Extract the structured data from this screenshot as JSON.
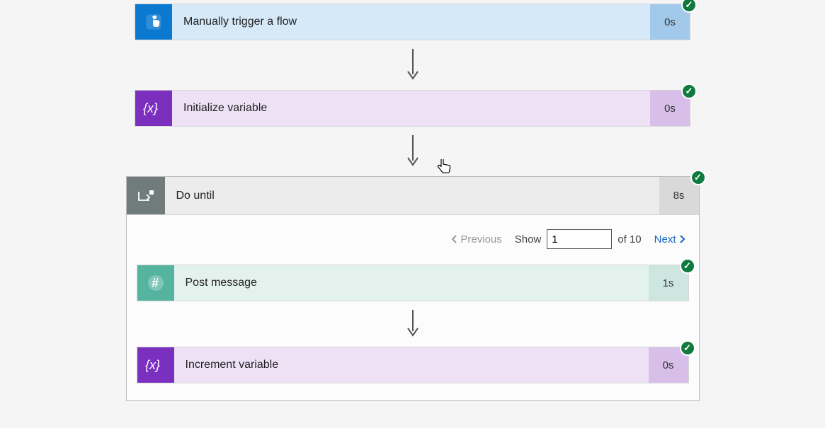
{
  "steps": {
    "trigger": {
      "label": "Manually trigger a flow",
      "time": "0s"
    },
    "initVar": {
      "label": "Initialize variable",
      "time": "0s"
    },
    "doUntil": {
      "label": "Do until",
      "time": "8s"
    },
    "postMsg": {
      "label": "Post message",
      "time": "1s"
    },
    "incVar": {
      "label": "Increment variable",
      "time": "0s"
    }
  },
  "pager": {
    "previous_label": "Previous",
    "show_label": "Show",
    "current": "1",
    "of_label": "of 10",
    "next_label": "Next"
  },
  "icons": {
    "check": "✓"
  }
}
